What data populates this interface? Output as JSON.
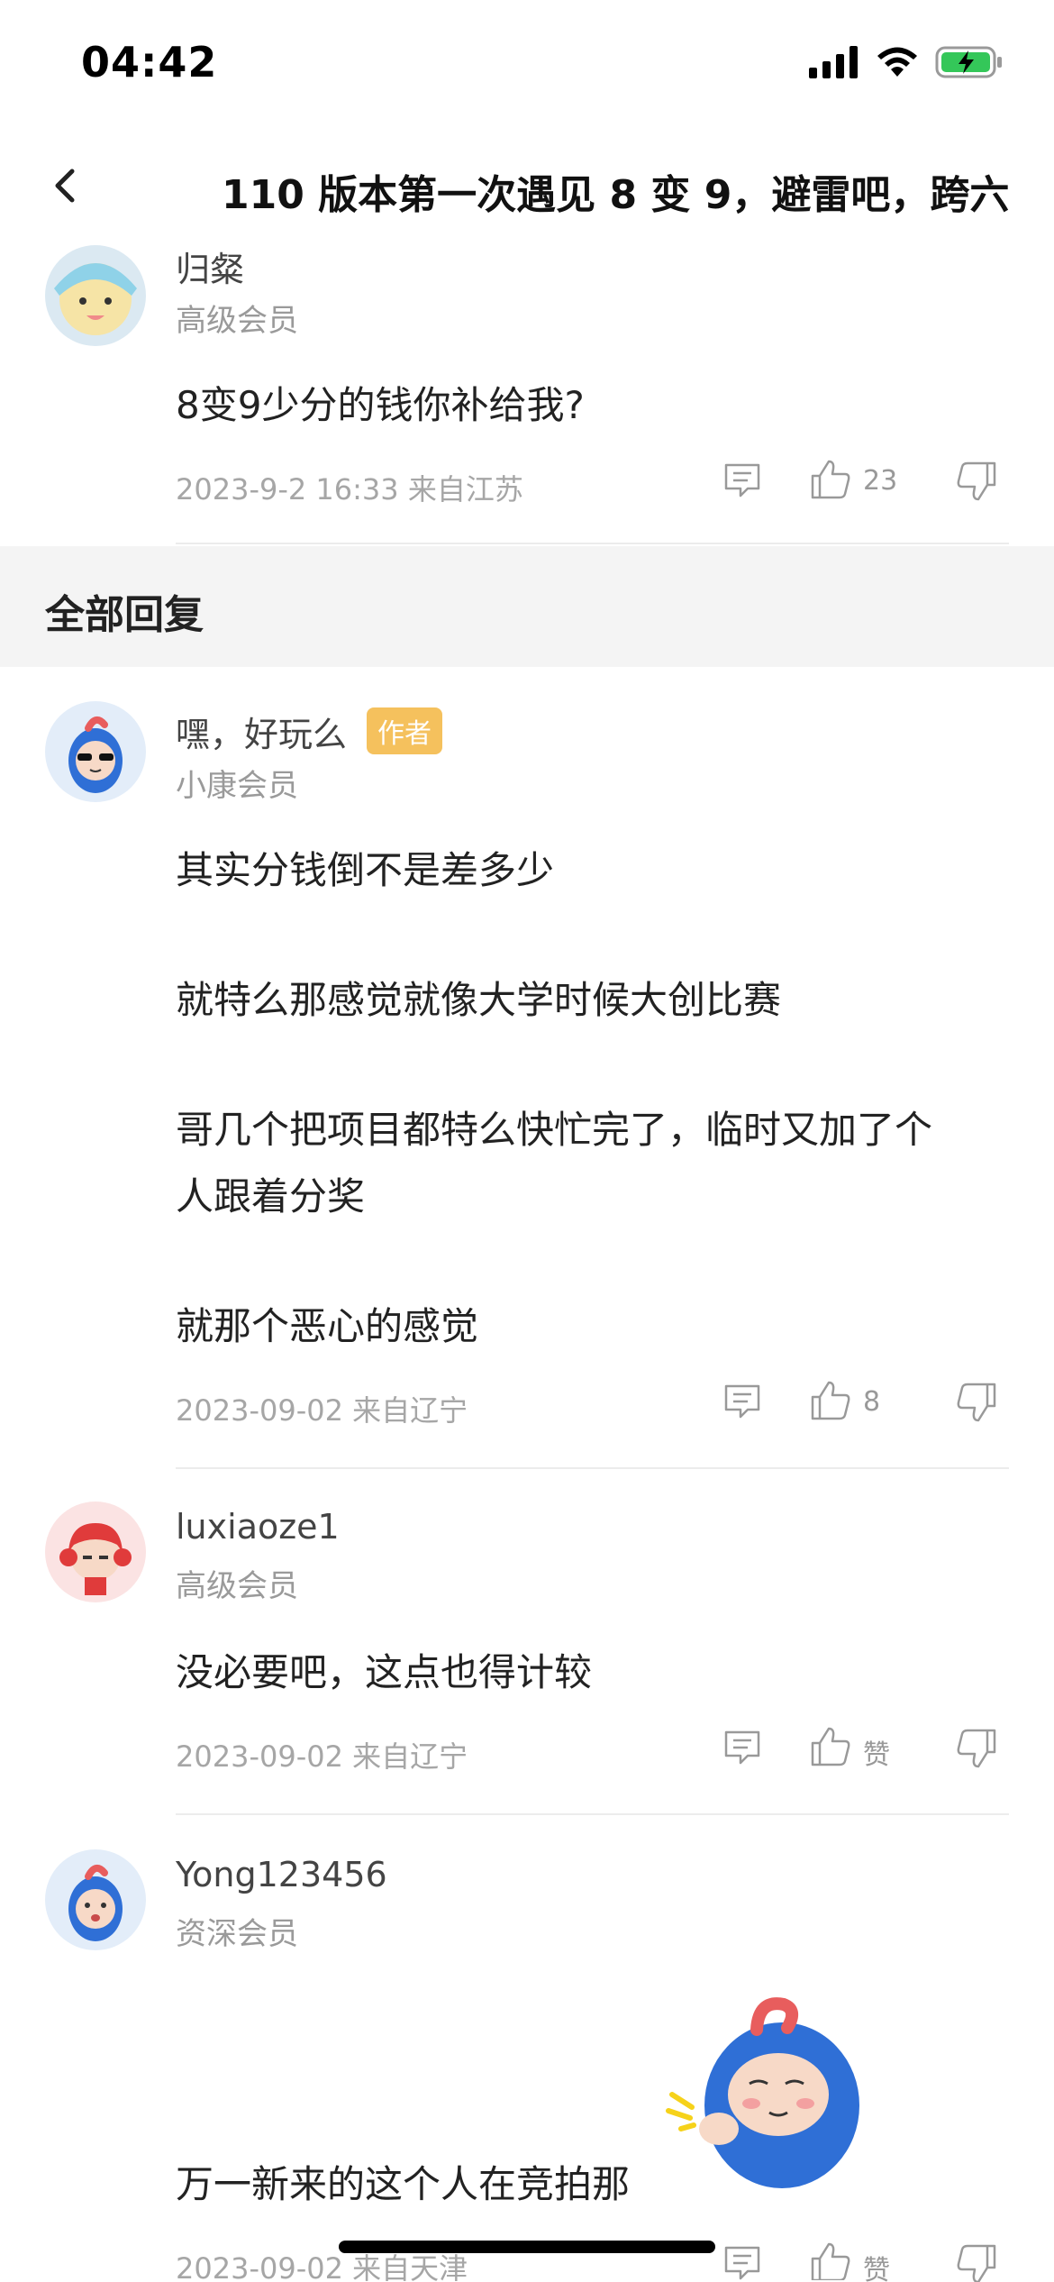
{
  "status_bar": {
    "time": "04:42"
  },
  "nav": {
    "title": "110 版本第一次遇见 8 变 9，避雷吧，跨六"
  },
  "top_comment": {
    "username": "归粲",
    "member_level": "高级会员",
    "content": "8变9少分的钱你补给我?",
    "meta": "2023-9-2 16:33  来自江苏",
    "like_count": "23"
  },
  "section": {
    "title": "全部回复"
  },
  "replies": [
    {
      "username": "嘿，好玩么",
      "badge": "作者",
      "member_level": "小康会员",
      "lines": [
        "其实分钱倒不是差多少",
        "就特么那感觉就像大学时候大创比赛",
        "哥几个把项目都特么快忙完了，临时又加了个",
        "人跟着分奖",
        "就那个恶心的感觉"
      ],
      "meta": "2023-09-02 来自辽宁",
      "like_count": "8"
    },
    {
      "username": "luxiaoze1",
      "member_level": "高级会员",
      "lines": [
        "没必要吧，这点也得计较"
      ],
      "meta": "2023-09-02 来自辽宁",
      "like_count": "赞"
    },
    {
      "username": "Yong123456",
      "member_level": "资深会员",
      "lines": [
        "万一新来的这个人在竞拍那"
      ],
      "meta": "2023-09-02 来自天津",
      "like_count": "赞"
    }
  ],
  "colors": {
    "accent_badge": "#f5c15d",
    "section_bg": "#f4f4f4",
    "meta_text": "#a6a6a6"
  },
  "icons": [
    "signal-icon",
    "wifi-icon",
    "battery-charging-icon",
    "back-chevron-icon",
    "reply-icon",
    "thumb-up-icon",
    "thumb-down-icon"
  ]
}
